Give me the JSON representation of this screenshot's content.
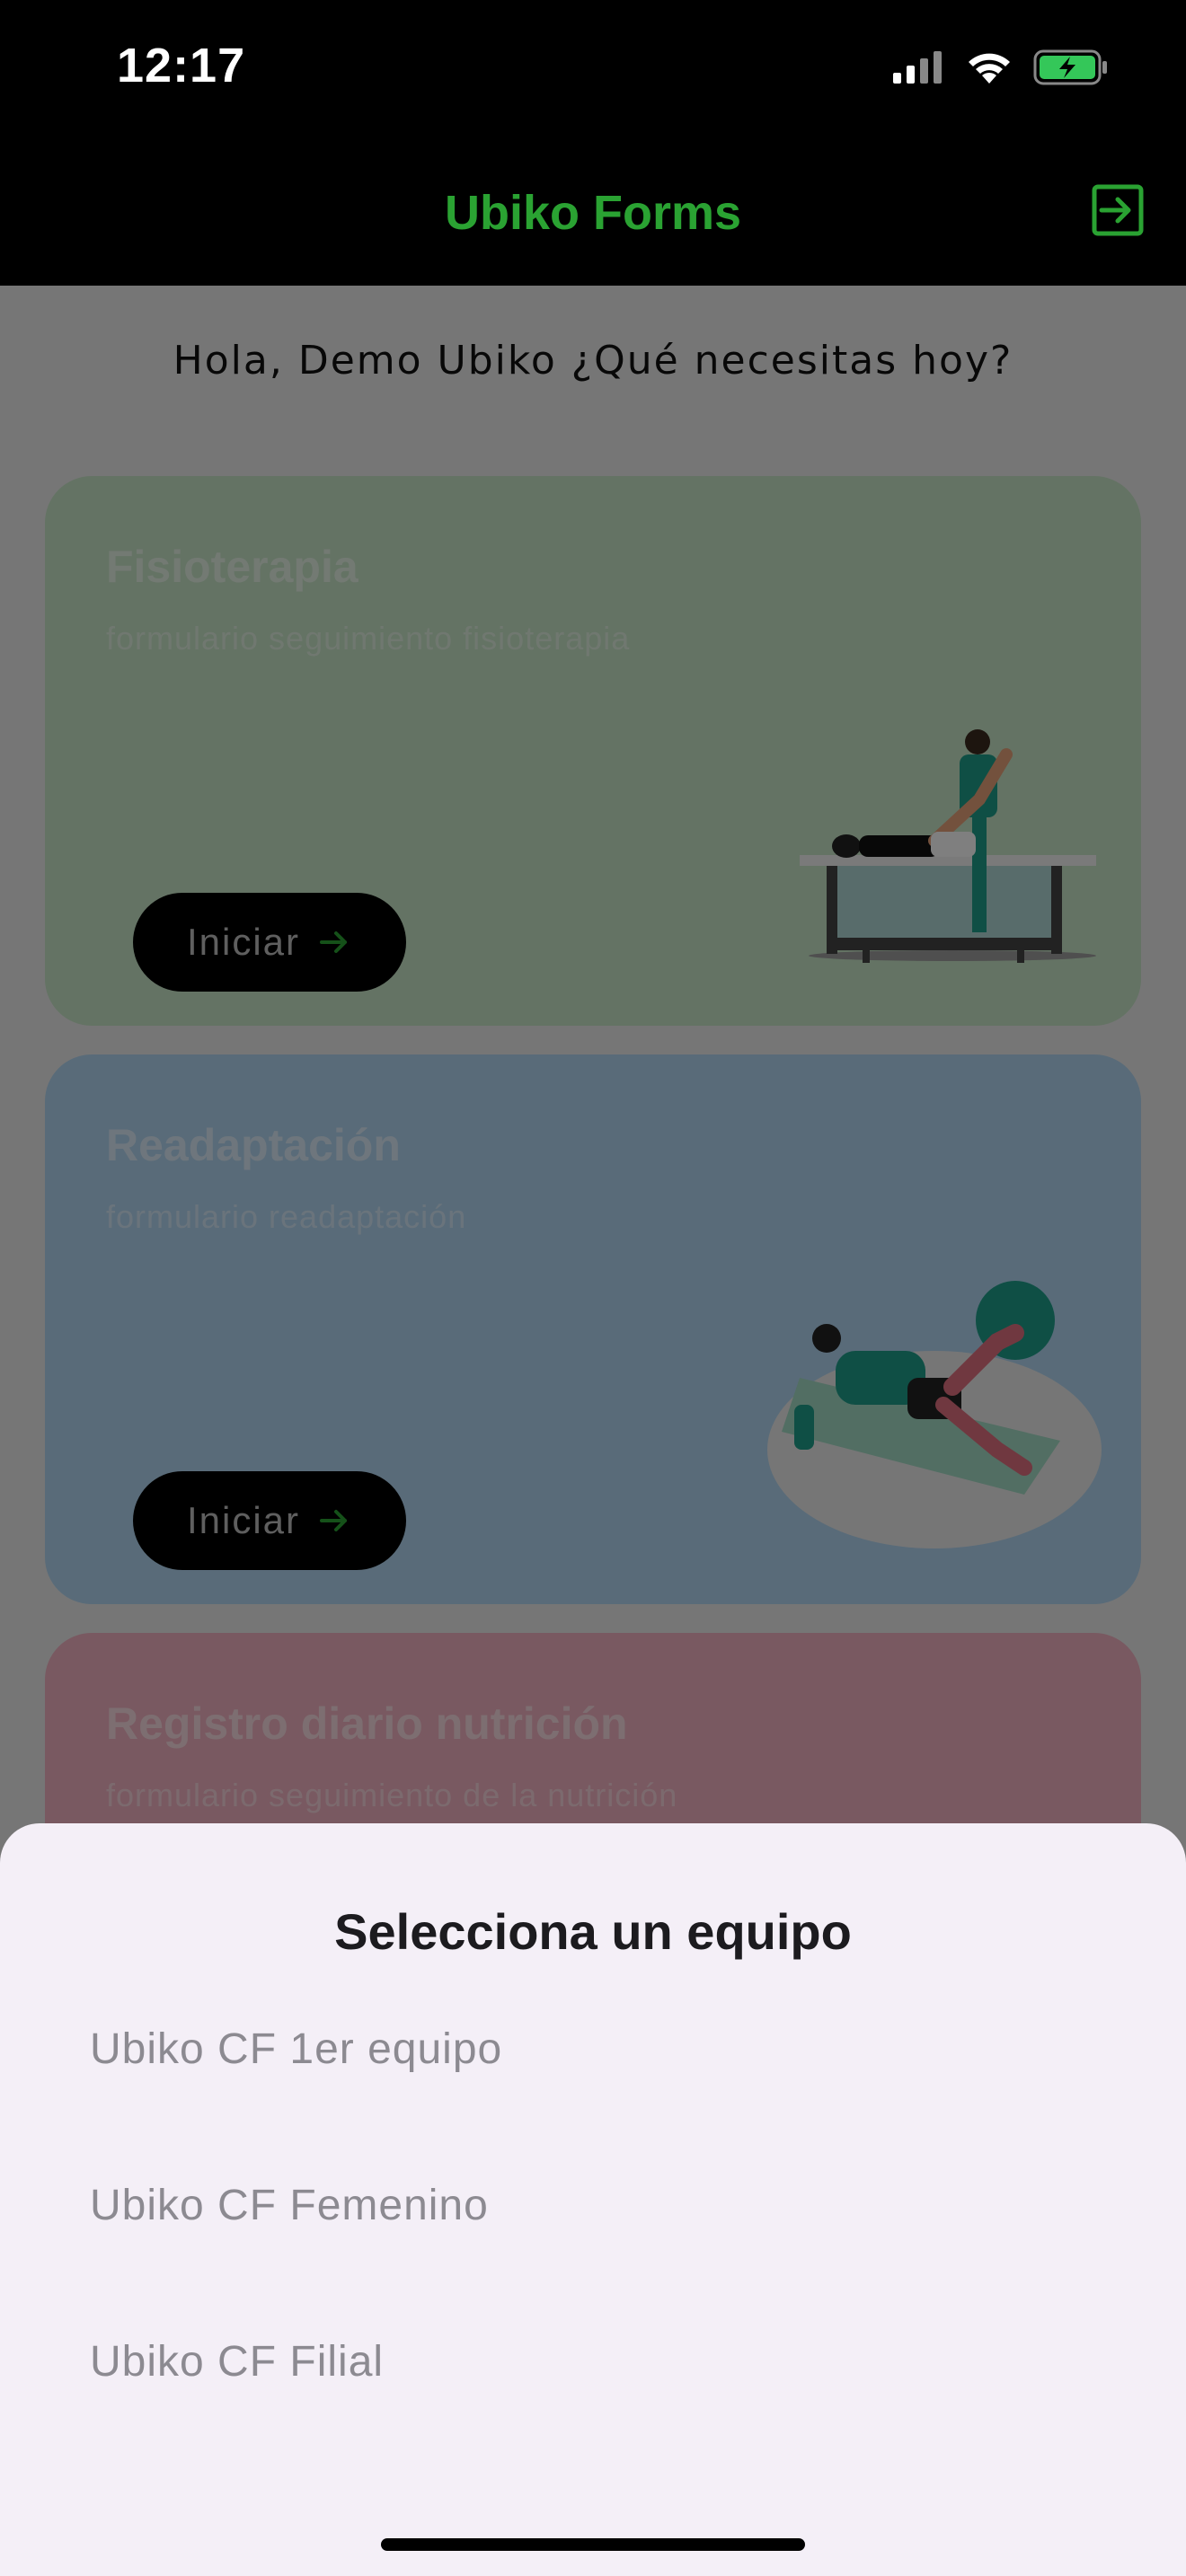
{
  "status_bar": {
    "time": "12:17"
  },
  "header": {
    "title": "Ubiko Forms",
    "logout_icon": "logout-icon",
    "accent": "#2aa232"
  },
  "greeting": "Hola, Demo Ubiko ¿Qué necesitas hoy?",
  "cards": [
    {
      "title": "Fisioterapia",
      "subtitle": "formulario seguimiento fisioterapia",
      "button": "Iniciar",
      "color": "#c8e6c9"
    },
    {
      "title": "Readaptación",
      "subtitle": "formulario readaptación",
      "button": "Iniciar",
      "color": "#b3d7f3"
    },
    {
      "title": "Registro diario nutrición",
      "subtitle": "formulario seguimiento de la nutrición",
      "color": "#f3b3c2"
    }
  ],
  "sheet": {
    "title": "Selecciona un equipo",
    "teams": [
      "Ubiko CF 1er equipo",
      "Ubiko CF Femenino",
      "Ubiko CF Filial"
    ]
  }
}
